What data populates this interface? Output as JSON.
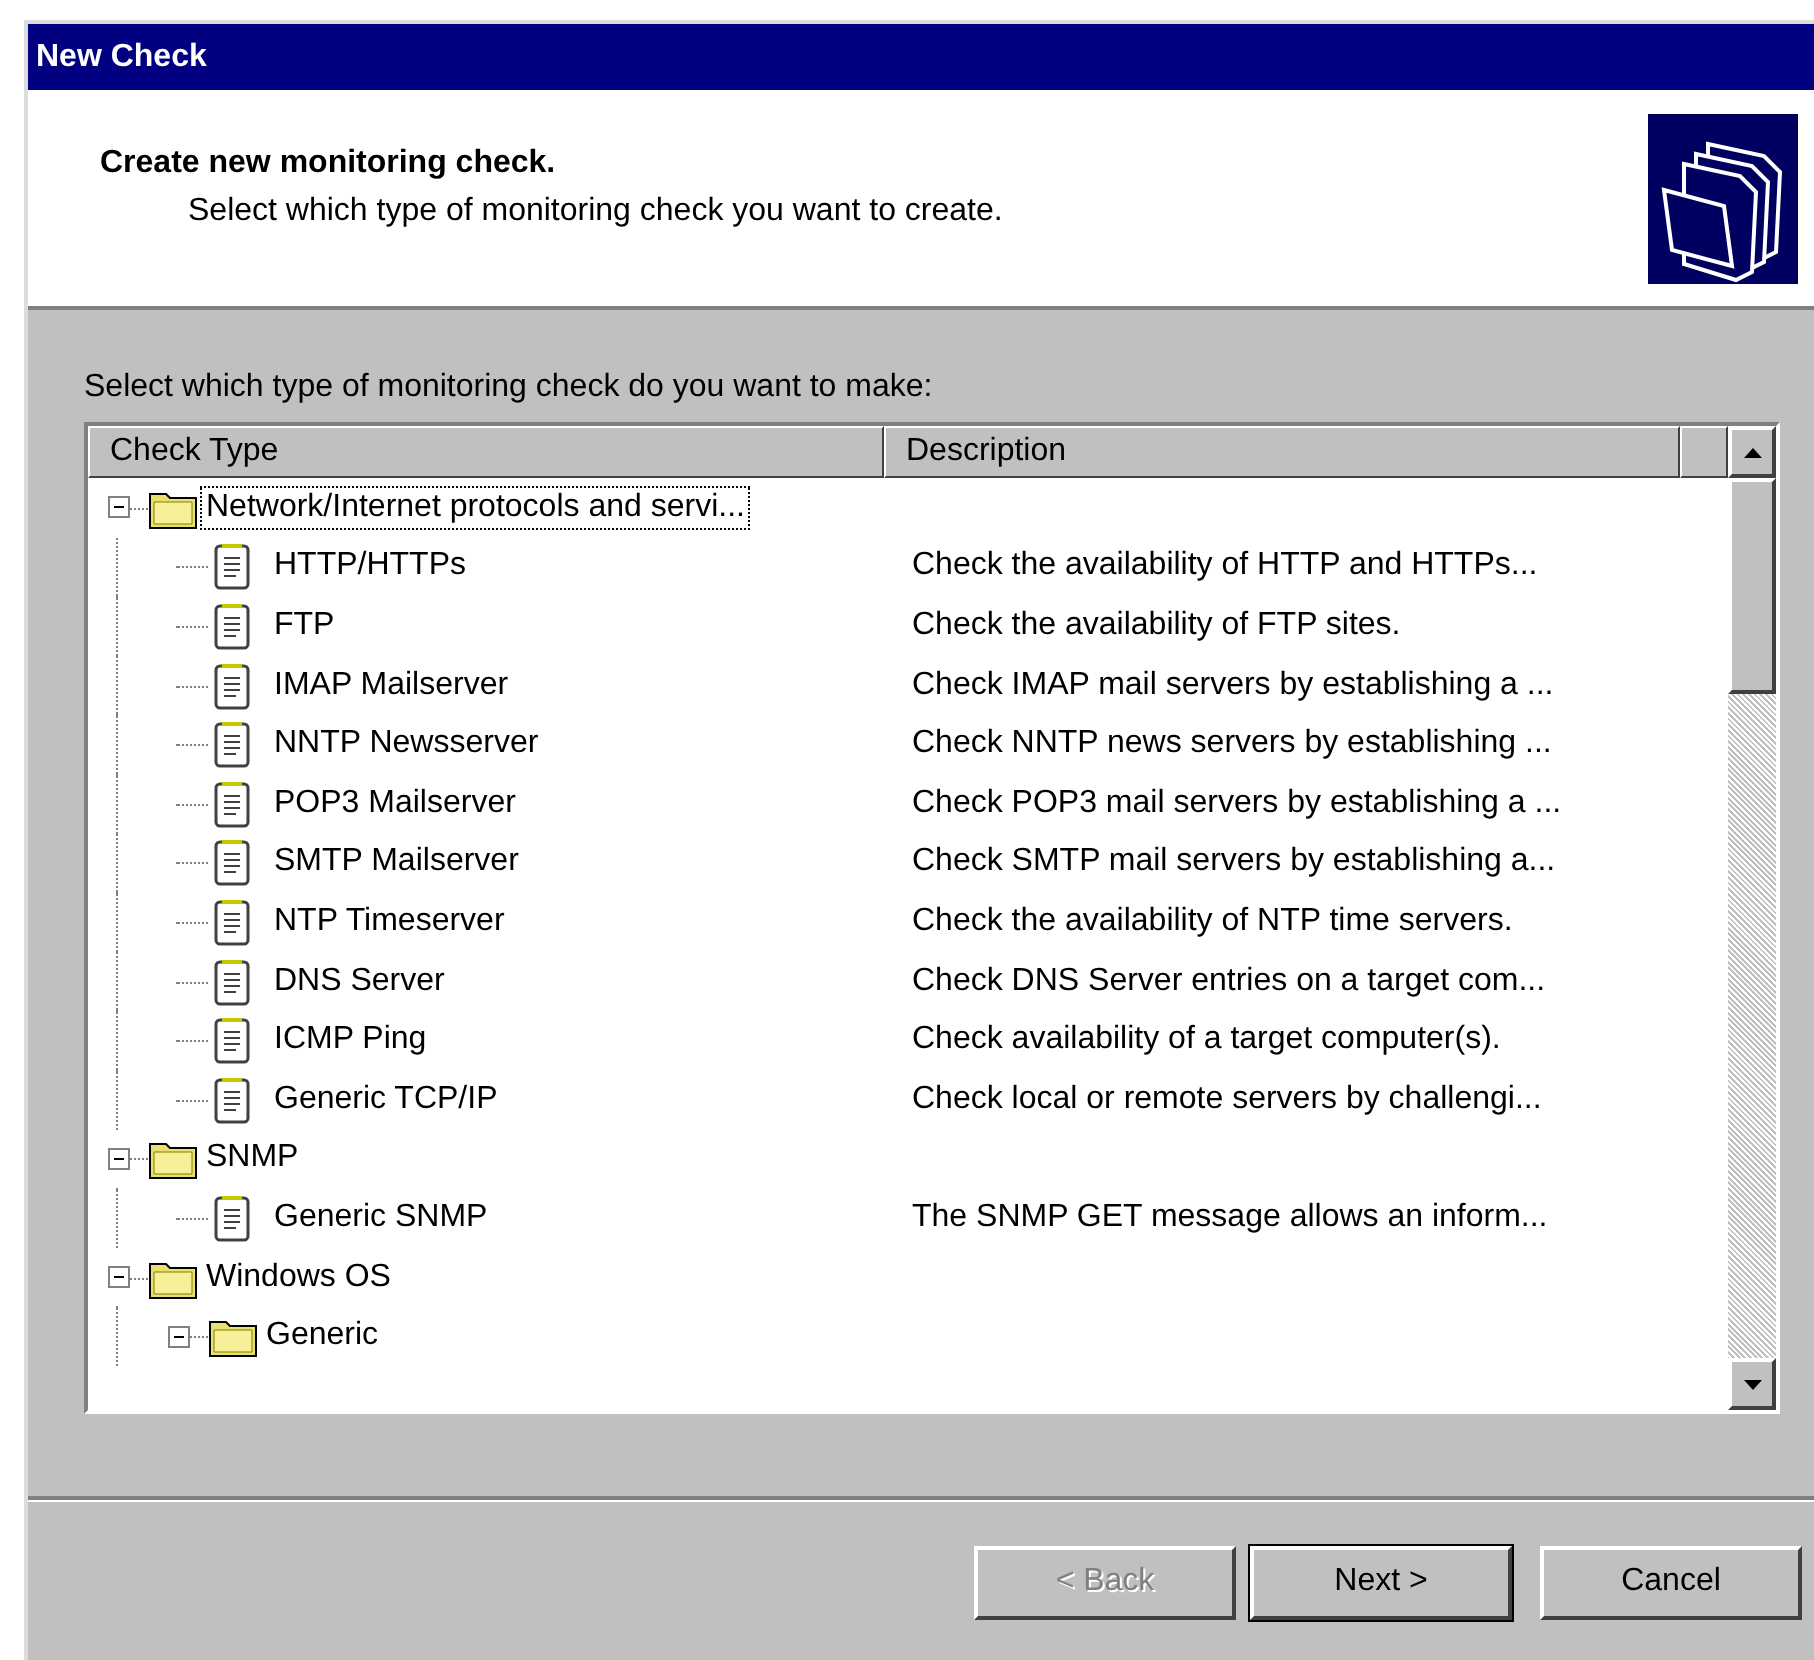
{
  "window": {
    "title": "New Check"
  },
  "header": {
    "title": "Create new monitoring check.",
    "subtitle": "Select which type of monitoring check you want to create."
  },
  "prompt": "Select which type of monitoring check do you want to make:",
  "tree": {
    "columns": [
      "Check Type",
      "Description"
    ],
    "nodes": [
      {
        "kind": "group",
        "label": "Network/Internet protocols and servi...",
        "expanded": true,
        "focused": true,
        "children": [
          {
            "kind": "check",
            "label": "HTTP/HTTPs",
            "description": "Check the availability of HTTP and HTTPs...",
            "focused": false
          },
          {
            "kind": "check",
            "label": "FTP",
            "description": "Check the availability of FTP sites.",
            "focused": false
          },
          {
            "kind": "check",
            "label": "IMAP Mailserver",
            "description": "Check IMAP mail servers by establishing a ...",
            "focused": false
          },
          {
            "kind": "check",
            "label": "NNTP Newsserver",
            "description": "Check NNTP news servers by establishing ...",
            "focused": false
          },
          {
            "kind": "check",
            "label": "POP3 Mailserver",
            "description": "Check POP3 mail servers by establishing a ...",
            "focused": false
          },
          {
            "kind": "check",
            "label": "SMTP Mailserver",
            "description": "Check SMTP mail servers by establishing a...",
            "focused": false
          },
          {
            "kind": "check",
            "label": "NTP Timeserver",
            "description": "Check the availability of NTP time servers.",
            "focused": false
          },
          {
            "kind": "check",
            "label": "DNS Server",
            "description": "Check DNS Server entries on a target com...",
            "focused": false
          },
          {
            "kind": "check",
            "label": "ICMP Ping",
            "description": "Check availability of a target computer(s).",
            "focused": false
          },
          {
            "kind": "check",
            "label": "Generic TCP/IP",
            "description": "Check local or remote servers by challengi...",
            "focused": false
          }
        ]
      },
      {
        "kind": "group",
        "label": "SNMP",
        "expanded": true,
        "focused": false,
        "children": [
          {
            "kind": "check",
            "label": "Generic SNMP",
            "description": "The SNMP GET message allows an inform...",
            "focused": false
          }
        ]
      },
      {
        "kind": "group",
        "label": "Windows OS",
        "expanded": true,
        "focused": false,
        "children": [
          {
            "kind": "group",
            "label": "Generic",
            "expanded": true,
            "focused": false
          }
        ]
      }
    ]
  },
  "buttons": [
    {
      "label": "< Back",
      "disabled": true,
      "default": false
    },
    {
      "label": "Next >",
      "disabled": false,
      "default": true
    },
    {
      "label": "Cancel",
      "disabled": false,
      "default": false
    }
  ]
}
